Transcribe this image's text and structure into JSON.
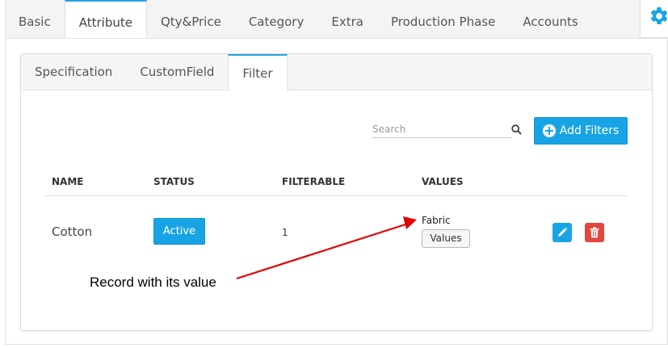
{
  "top_tabs": [
    "Basic",
    "Attribute",
    "Qty&Price",
    "Category",
    "Extra",
    "Production Phase",
    "Accounts"
  ],
  "top_tab_active": "Attribute",
  "sub_tabs": [
    "Specification",
    "CustomField",
    "Filter"
  ],
  "sub_tab_active": "Filter",
  "search": {
    "placeholder": "Search"
  },
  "add_button": {
    "label": "Add Filters"
  },
  "table": {
    "headers": {
      "name": "NAME",
      "status": "STATUS",
      "filterable": "FILTERABLE",
      "values": "VALUES"
    },
    "rows": [
      {
        "name": "Cotton",
        "status": "Active",
        "filterable": "1",
        "value_text": "Fabric",
        "values_button": "Values"
      }
    ]
  },
  "annotation": {
    "text": "Record with its value"
  },
  "colors": {
    "accent": "#18a4e4",
    "danger": "#e0473e",
    "arrow": "#e00000"
  },
  "icons": {
    "gear": "gear-icon",
    "search": "search-icon",
    "plus": "plus-circle-icon",
    "edit": "pencil-icon",
    "delete": "trash-icon"
  }
}
